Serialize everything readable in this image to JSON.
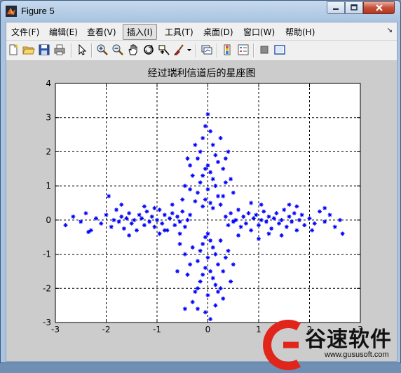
{
  "window": {
    "title": "Figure 5"
  },
  "menu": {
    "items": [
      "文件(F)",
      "编辑(E)",
      "查看(V)",
      "插入(I)",
      "工具(T)",
      "桌面(D)",
      "窗口(W)",
      "帮助(H)"
    ],
    "active_index": 3
  },
  "toolbar": {
    "icons": [
      "new-figure-icon",
      "open-file-icon",
      "save-icon",
      "print-icon",
      "pointer-icon",
      "zoom-in-icon",
      "zoom-out-icon",
      "pan-hand-icon",
      "rotate-3d-icon",
      "data-cursor-icon",
      "brush-icon",
      "link-plot-icon",
      "colorbar-icon",
      "legend-icon",
      "hide-plot-tools-icon",
      "show-plot-tools-icon"
    ]
  },
  "chart_data": {
    "type": "scatter",
    "title": "经过瑞利信道后的星座图",
    "xlim": [
      -3,
      3
    ],
    "ylim": [
      -3,
      4
    ],
    "xticks": [
      "-3",
      "-2",
      "-1",
      "0",
      "1",
      "2",
      "3"
    ],
    "yticks": [
      "-3",
      "-2",
      "-1",
      "0",
      "1",
      "2",
      "3",
      "4"
    ],
    "grid": true,
    "marker": "*",
    "color": "#0000ff",
    "series": [
      {
        "points": [
          [
            -2.8,
            -0.15
          ],
          [
            -2.65,
            0.1
          ],
          [
            -2.5,
            -0.05
          ],
          [
            -2.4,
            0.2
          ],
          [
            -2.3,
            -0.3
          ],
          [
            -2.2,
            0.05
          ],
          [
            -2.1,
            -0.1
          ],
          [
            -2.0,
            0.15
          ],
          [
            -1.9,
            -0.2
          ],
          [
            -1.85,
            0.0
          ],
          [
            -1.8,
            0.3
          ],
          [
            -1.75,
            -0.05
          ],
          [
            -1.7,
            0.1
          ],
          [
            -1.65,
            -0.25
          ],
          [
            -1.6,
            0.05
          ],
          [
            -1.55,
            0.2
          ],
          [
            -1.5,
            -0.1
          ],
          [
            -1.45,
            0.0
          ],
          [
            -1.4,
            -0.3
          ],
          [
            -1.35,
            0.15
          ],
          [
            -1.3,
            0.05
          ],
          [
            -1.25,
            -0.15
          ],
          [
            -1.2,
            0.25
          ],
          [
            -1.15,
            -0.05
          ],
          [
            -1.1,
            0.1
          ],
          [
            -1.05,
            -0.2
          ],
          [
            -1.0,
            0.0
          ],
          [
            -0.95,
            0.3
          ],
          [
            -0.9,
            -0.1
          ],
          [
            -0.85,
            0.15
          ],
          [
            -0.8,
            -0.3
          ],
          [
            -0.75,
            0.05
          ],
          [
            -0.7,
            0.2
          ],
          [
            -0.65,
            -0.15
          ],
          [
            -0.6,
            0.1
          ],
          [
            -0.55,
            -0.05
          ],
          [
            -0.5,
            0.25
          ],
          [
            -0.45,
            -0.2
          ],
          [
            -0.4,
            0.0
          ],
          [
            -0.35,
            0.15
          ],
          [
            -1.95,
            0.7
          ],
          [
            -1.55,
            -0.45
          ],
          [
            -1.25,
            0.4
          ],
          [
            -0.95,
            -0.4
          ],
          [
            -0.7,
            0.45
          ],
          [
            -2.35,
            -0.35
          ],
          [
            -1.7,
            0.45
          ],
          [
            -1.05,
            0.35
          ],
          [
            -0.55,
            -0.4
          ],
          [
            -0.85,
            -0.3
          ],
          [
            0.35,
            0.1
          ],
          [
            0.4,
            -0.15
          ],
          [
            0.45,
            0.2
          ],
          [
            0.5,
            -0.05
          ],
          [
            0.55,
            0.0
          ],
          [
            0.6,
            0.3
          ],
          [
            0.65,
            -0.2
          ],
          [
            0.7,
            0.1
          ],
          [
            0.75,
            -0.1
          ],
          [
            0.8,
            0.2
          ],
          [
            0.85,
            -0.3
          ],
          [
            0.9,
            0.05
          ],
          [
            0.95,
            0.15
          ],
          [
            1.0,
            -0.15
          ],
          [
            1.05,
            0.0
          ],
          [
            1.1,
            0.25
          ],
          [
            1.15,
            -0.05
          ],
          [
            1.2,
            0.1
          ],
          [
            1.25,
            -0.25
          ],
          [
            1.3,
            0.05
          ],
          [
            1.35,
            0.2
          ],
          [
            1.4,
            -0.1
          ],
          [
            1.45,
            0.0
          ],
          [
            1.5,
            0.3
          ],
          [
            1.55,
            -0.2
          ],
          [
            1.6,
            0.1
          ],
          [
            1.65,
            -0.05
          ],
          [
            1.7,
            0.2
          ],
          [
            1.75,
            -0.3
          ],
          [
            1.8,
            0.0
          ],
          [
            1.85,
            0.15
          ],
          [
            1.9,
            -0.15
          ],
          [
            2.0,
            0.05
          ],
          [
            2.1,
            -0.1
          ],
          [
            2.2,
            0.25
          ],
          [
            2.3,
            -0.05
          ],
          [
            2.4,
            0.15
          ],
          [
            2.5,
            -0.2
          ],
          [
            2.6,
            0.0
          ],
          [
            2.65,
            -0.4
          ],
          [
            1.05,
            0.45
          ],
          [
            1.45,
            -0.45
          ],
          [
            0.85,
            0.5
          ],
          [
            1.75,
            0.4
          ],
          [
            2.05,
            -0.3
          ],
          [
            0.6,
            -0.45
          ],
          [
            1.2,
            -0.4
          ],
          [
            2.3,
            0.35
          ],
          [
            1.0,
            -0.55
          ],
          [
            1.6,
            0.45
          ],
          [
            0.0,
            3.1
          ],
          [
            -0.05,
            2.75
          ],
          [
            0.05,
            2.6
          ],
          [
            -0.1,
            2.4
          ],
          [
            0.1,
            2.2
          ],
          [
            -0.15,
            2.0
          ],
          [
            0.15,
            1.9
          ],
          [
            -0.2,
            1.8
          ],
          [
            0.2,
            1.7
          ],
          [
            0.0,
            1.6
          ],
          [
            -0.05,
            1.5
          ],
          [
            0.05,
            1.4
          ],
          [
            -0.1,
            1.3
          ],
          [
            0.1,
            1.2
          ],
          [
            -0.15,
            1.1
          ],
          [
            0.15,
            1.0
          ],
          [
            0.0,
            0.9
          ],
          [
            -0.2,
            0.8
          ],
          [
            0.2,
            0.7
          ],
          [
            -0.05,
            0.6
          ],
          [
            0.05,
            0.5
          ],
          [
            -0.1,
            0.4
          ],
          [
            0.1,
            0.35
          ],
          [
            0.3,
            1.5
          ],
          [
            -0.3,
            1.3
          ],
          [
            0.35,
            1.1
          ],
          [
            -0.35,
            0.9
          ],
          [
            0.3,
            0.7
          ],
          [
            -0.25,
            0.55
          ],
          [
            0.25,
            0.45
          ],
          [
            -0.4,
            1.8
          ],
          [
            0.4,
            2.0
          ],
          [
            -0.25,
            2.2
          ],
          [
            0.25,
            2.4
          ],
          [
            0.45,
            1.2
          ],
          [
            -0.45,
            1.0
          ],
          [
            0.5,
            0.8
          ],
          [
            -0.5,
            0.6
          ],
          [
            0.35,
            1.8
          ],
          [
            -0.35,
            1.6
          ],
          [
            0.0,
            -0.4
          ],
          [
            -0.05,
            -0.5
          ],
          [
            0.05,
            -0.6
          ],
          [
            -0.1,
            -0.7
          ],
          [
            0.1,
            -0.8
          ],
          [
            -0.15,
            -0.9
          ],
          [
            0.15,
            -1.0
          ],
          [
            0.0,
            -1.1
          ],
          [
            -0.2,
            -1.2
          ],
          [
            0.2,
            -1.3
          ],
          [
            -0.05,
            -1.4
          ],
          [
            0.05,
            -1.5
          ],
          [
            -0.1,
            -1.6
          ],
          [
            0.1,
            -1.7
          ],
          [
            -0.15,
            -1.8
          ],
          [
            0.15,
            -1.9
          ],
          [
            -0.2,
            -2.0
          ],
          [
            0.2,
            -2.1
          ],
          [
            0.0,
            -2.2
          ],
          [
            -0.3,
            -2.4
          ],
          [
            0.3,
            -2.3
          ],
          [
            -0.45,
            -2.6
          ],
          [
            0.05,
            -2.9
          ],
          [
            -0.05,
            -2.7
          ],
          [
            0.25,
            -0.6
          ],
          [
            -0.3,
            -0.8
          ],
          [
            0.35,
            -1.1
          ],
          [
            -0.35,
            -1.3
          ],
          [
            0.3,
            -1.5
          ],
          [
            -0.4,
            -1.6
          ],
          [
            0.45,
            -1.8
          ],
          [
            -0.25,
            -2.1
          ],
          [
            0.4,
            -0.9
          ],
          [
            -0.45,
            -1.0
          ],
          [
            0.5,
            -1.3
          ],
          [
            -0.55,
            -0.7
          ],
          [
            0.25,
            -2.0
          ],
          [
            -0.6,
            -1.5
          ],
          [
            0.15,
            -2.5
          ],
          [
            -0.2,
            -2.6
          ]
        ]
      }
    ]
  },
  "watermark": {
    "brand": "谷速软件",
    "url": "www.gususoft.com"
  }
}
